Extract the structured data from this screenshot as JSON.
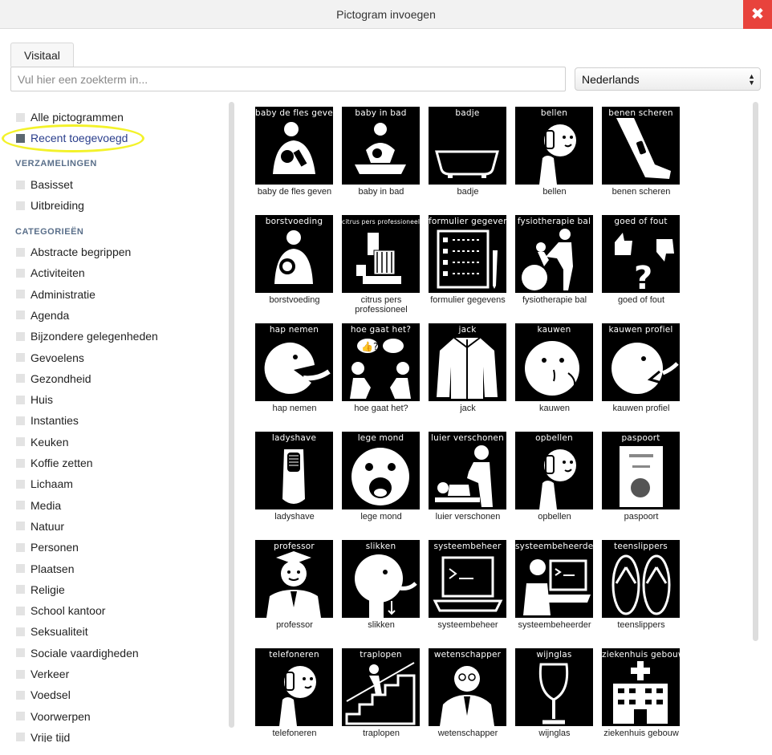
{
  "window": {
    "title": "Pictogram invoegen"
  },
  "tabs": [
    {
      "label": "Visitaal"
    }
  ],
  "search": {
    "placeholder": "Vul hier een zoekterm in..."
  },
  "language": {
    "selected": "Nederlands"
  },
  "sidebar": {
    "top_items": [
      {
        "label": "Alle pictogrammen",
        "active": false
      },
      {
        "label": "Recent toegevoegd",
        "active": true
      }
    ],
    "collections_header": "VERZAMELINGEN",
    "collections": [
      {
        "label": "Basisset"
      },
      {
        "label": "Uitbreiding"
      }
    ],
    "categories_header": "CATEGORIEËN",
    "categories": [
      {
        "label": "Abstracte begrippen"
      },
      {
        "label": "Activiteiten"
      },
      {
        "label": "Administratie"
      },
      {
        "label": "Agenda"
      },
      {
        "label": "Bijzondere gelegenheden"
      },
      {
        "label": "Gevoelens"
      },
      {
        "label": "Gezondheid"
      },
      {
        "label": "Huis"
      },
      {
        "label": "Instanties"
      },
      {
        "label": "Keuken"
      },
      {
        "label": "Koffie zetten"
      },
      {
        "label": "Lichaam"
      },
      {
        "label": "Media"
      },
      {
        "label": "Natuur"
      },
      {
        "label": "Personen"
      },
      {
        "label": "Plaatsen"
      },
      {
        "label": "Religie"
      },
      {
        "label": "School kantoor"
      },
      {
        "label": "Seksualiteit"
      },
      {
        "label": "Sociale vaardigheden"
      },
      {
        "label": "Verkeer"
      },
      {
        "label": "Voedsel"
      },
      {
        "label": "Voorwerpen"
      },
      {
        "label": "Vrije tijd"
      }
    ]
  },
  "pictograms": [
    {
      "tile": "baby de fles geven",
      "caption": "baby de fles geven",
      "icon": "bottle-feeding-icon"
    },
    {
      "tile": "baby in bad",
      "caption": "baby in bad",
      "icon": "baby-bath-icon"
    },
    {
      "tile": "badje",
      "caption": "badje",
      "icon": "bathtub-icon"
    },
    {
      "tile": "bellen",
      "caption": "bellen",
      "icon": "phone-call-icon"
    },
    {
      "tile": "benen scheren",
      "caption": "benen scheren",
      "icon": "leg-shave-icon"
    },
    {
      "tile": "borstvoeding",
      "caption": "borstvoeding",
      "icon": "breastfeeding-icon"
    },
    {
      "tile": "citrus pers professioneel",
      "caption": "citrus pers professioneel",
      "icon": "juicer-icon"
    },
    {
      "tile": "formulier gegevens",
      "caption": "formulier gegevens",
      "icon": "form-icon"
    },
    {
      "tile": "fysiotherapie bal",
      "caption": "fysiotherapie bal",
      "icon": "physio-ball-icon"
    },
    {
      "tile": "goed of fout",
      "caption": "goed of fout",
      "icon": "thumbs-question-icon"
    },
    {
      "tile": "hap nemen",
      "caption": "hap nemen",
      "icon": "bite-icon"
    },
    {
      "tile": "hoe gaat het?",
      "caption": "hoe gaat het?",
      "icon": "conversation-icon"
    },
    {
      "tile": "jack",
      "caption": "jack",
      "icon": "jacket-icon"
    },
    {
      "tile": "kauwen",
      "caption": "kauwen",
      "icon": "chewing-icon"
    },
    {
      "tile": "kauwen profiel",
      "caption": "kauwen profiel",
      "icon": "chewing-profile-icon"
    },
    {
      "tile": "ladyshave",
      "caption": "ladyshave",
      "icon": "shaver-icon"
    },
    {
      "tile": "lege mond",
      "caption": "lege mond",
      "icon": "open-mouth-icon"
    },
    {
      "tile": "luier verschonen",
      "caption": "luier verschonen",
      "icon": "diaper-change-icon"
    },
    {
      "tile": "opbellen",
      "caption": "opbellen",
      "icon": "phone-call-icon"
    },
    {
      "tile": "paspoort",
      "caption": "paspoort",
      "icon": "passport-icon"
    },
    {
      "tile": "professor",
      "caption": "professor",
      "icon": "professor-icon"
    },
    {
      "tile": "slikken",
      "caption": "slikken",
      "icon": "swallow-icon"
    },
    {
      "tile": "systeembeheer",
      "caption": "systeembeheer",
      "icon": "laptop-terminal-icon"
    },
    {
      "tile": "systeembeheerder",
      "caption": "systeembeheerder",
      "icon": "sysadmin-icon"
    },
    {
      "tile": "teenslippers",
      "caption": "teenslippers",
      "icon": "flipflops-icon"
    },
    {
      "tile": "telefoneren",
      "caption": "telefoneren",
      "icon": "phone-call-icon"
    },
    {
      "tile": "traplopen",
      "caption": "traplopen",
      "icon": "stairs-icon"
    },
    {
      "tile": "wetenschapper",
      "caption": "wetenschapper",
      "icon": "scientist-icon"
    },
    {
      "tile": "wijnglas",
      "caption": "wijnglas",
      "icon": "wine-glass-icon"
    },
    {
      "tile": "ziekenhuis gebouw",
      "caption": "ziekenhuis gebouw",
      "icon": "hospital-icon"
    }
  ]
}
